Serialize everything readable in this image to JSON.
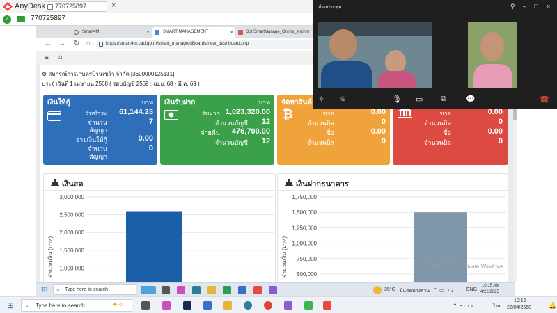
{
  "anydesk": {
    "app_name": "AnyDesk",
    "tab_label": "770725897",
    "address_value": "770725897"
  },
  "browser": {
    "tabs": [
      {
        "label": "Smart4M"
      },
      {
        "label": "SMART MANAGEMENT"
      },
      {
        "label": "3.3 SmartManage_Online_eruinnr"
      }
    ],
    "url": "https://smart4m.cad.go.th/smart_manage/dBoards/new_dashboard.php"
  },
  "page": {
    "coop_title": "สหกรณ์การเกษตรบ้านเขว้า จำกัด [3600000125131]",
    "date_line": "ประจำวันที่ 1 เมษายน 2568 ( รอบบัญชี 2569 : เม.ย. 68 - มี.ค. 69 )"
  },
  "cards": {
    "loan": {
      "title": "เงินให้กู้",
      "unit": "บาท",
      "row1_label": "รับชำระ",
      "row1_value": "61,144.23",
      "row2_label": "จำนวน",
      "row2_label_b": "สัญญา",
      "row2_value": "7",
      "row3_label": "จ่ายเงินให้กู้",
      "row3_value": "0.00",
      "row4_label": "จำนวน",
      "row4_label_b": "สัญญา",
      "row4_value": "0",
      "color": "#2f6fba"
    },
    "deposit": {
      "title": "เงินรับฝาก",
      "unit": "บาท",
      "row1_label": "รับฝาก",
      "row1_value": "1,023,320.00",
      "row2_label": "จำนวนบัญชี",
      "row2_value": "12",
      "row3_label": "จ่ายคืน",
      "row3_value": "476,700.00",
      "row4_label": "จำนวนบัญชี",
      "row4_value": "12",
      "color": "#3aa14a"
    },
    "sales": {
      "title": "จัดหาสินค้า",
      "row1_label": "ขาย",
      "row1_value": "0.00",
      "row2_label": "จำนวนบิล",
      "row2_value": "0",
      "row3_label": "ซื้อ",
      "row3_value": "0.00",
      "row4_label": "จำนวนบิล",
      "row4_value": "0",
      "color": "#f0a23b"
    },
    "other": {
      "row1_label": "ขาย",
      "row1_value": "0.00",
      "row2_label": "จำนวนบิล",
      "row2_value": "0",
      "row3_label": "ซื้อ",
      "row3_value": "0.00",
      "row4_label": "จำนวนบิล",
      "row4_value": "0",
      "color": "#dc4a42"
    }
  },
  "panels": {
    "cash_title": "เงินสด",
    "bank_title": "เงินฝากธนาคาร"
  },
  "chart_data": [
    {
      "type": "bar",
      "title": "",
      "ylabel": "จำนวนเงิน (บาท)",
      "yticks": [
        "3,000,000",
        "2,500,000",
        "2,000,000",
        "1,500,000",
        "1,000,000"
      ],
      "ylim_visible": [
        800000,
        3000000
      ],
      "values": [
        2580000
      ],
      "color": "#1a5fa8"
    },
    {
      "type": "bar",
      "title": "",
      "ylabel": "จำนวนเงิน (บาท)",
      "yticks": [
        "1,750,000",
        "1,500,000",
        "1,250,000",
        "1,000,000",
        "750,000",
        "500,000"
      ],
      "ylim_visible": [
        450000,
        1750000
      ],
      "values": [
        1500000
      ],
      "color": "#7f97aa"
    }
  ],
  "watermark": {
    "line1": "Activate Windows",
    "line2": "Go to Settings to activate Windows."
  },
  "remote_taskbar": {
    "search_placeholder": "Type here to search",
    "weather": "35°C",
    "weather_desc": "มีแดดบางส่วน",
    "lang": "ENG",
    "time": "10:15 AM",
    "date": "4/22/2025"
  },
  "local_taskbar": {
    "search_placeholder": "Type here to search",
    "lang": "ไทย",
    "time": "10:15",
    "date": "22/04/2568"
  },
  "meeting": {
    "title": "ห้องประชุม"
  }
}
